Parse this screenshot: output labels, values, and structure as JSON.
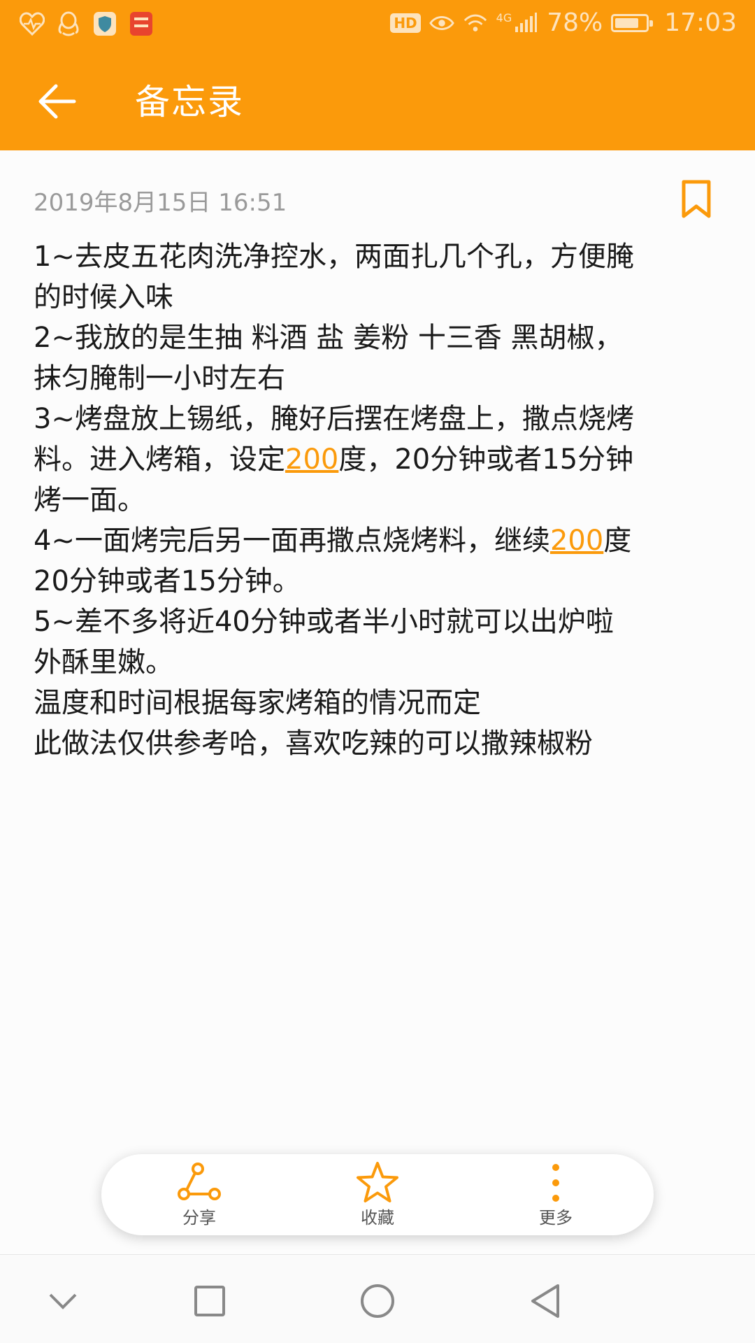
{
  "status_bar": {
    "left_icons": [
      "heart-monitor-icon",
      "qq-icon",
      "shield-icon",
      "taobao-daily-icon"
    ],
    "hd_label": "HD",
    "network_label": "4G",
    "battery_percent_label": "78%",
    "battery_level": 0.78,
    "time": "17:03"
  },
  "app_bar": {
    "back_icon": "arrow-left-icon",
    "title": "备忘录"
  },
  "note": {
    "date": "2019年8月15日 16:51",
    "bookmark_icon": "bookmark-icon",
    "lines": [
      "1~去皮五花肉洗净控水，两面扎几个孔，方便腌",
      "的时候入味",
      "2~我放的是生抽 料酒 盐 姜粉 十三香 黑胡椒，",
      "抹匀腌制一小时左右",
      "3~烤盘放上锡纸，腌好后摆在烤盘上，撒点烧烤"
    ],
    "line6": {
      "pre": "料。进入烤箱，设定",
      "link": "200",
      "post": "度，20分钟或者15分钟"
    },
    "line7": "烤一面。",
    "line8": {
      "pre": "4~一面烤完后另一面再撒点烧烤料，继续",
      "link": "200",
      "post": "度"
    },
    "lines_tail": [
      "20分钟或者15分钟。",
      "5~差不多将近40分钟或者半小时就可以出炉啦",
      "外酥里嫩。",
      "温度和时间根据每家烤箱的情况而定",
      "此做法仅供参考哈，喜欢吃辣的可以撒辣椒粉"
    ]
  },
  "actions": [
    {
      "label": "分享",
      "icon": "share-icon"
    },
    {
      "label": "收藏",
      "icon": "star-icon"
    },
    {
      "label": "更多",
      "icon": "more-vertical-icon"
    }
  ],
  "nav_bar": {
    "icons": [
      "chevron-down-icon",
      "square-recents-icon",
      "circle-home-icon",
      "triangle-back-icon"
    ]
  },
  "colors": {
    "accent": "#fb9a0b",
    "status_text": "#fde3bd",
    "body_text": "#1a1a1a",
    "date_text": "#9a9a9a"
  }
}
